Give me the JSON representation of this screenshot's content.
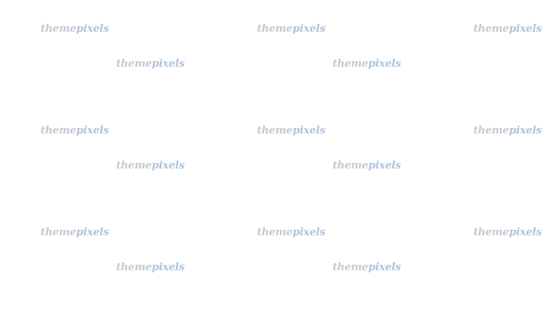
{
  "watermark": {
    "part1": "theme",
    "part2": "pixels"
  },
  "colors": {
    "part1": "#c6c9cd",
    "part2": "#adc4df",
    "background": "#ffffff"
  }
}
